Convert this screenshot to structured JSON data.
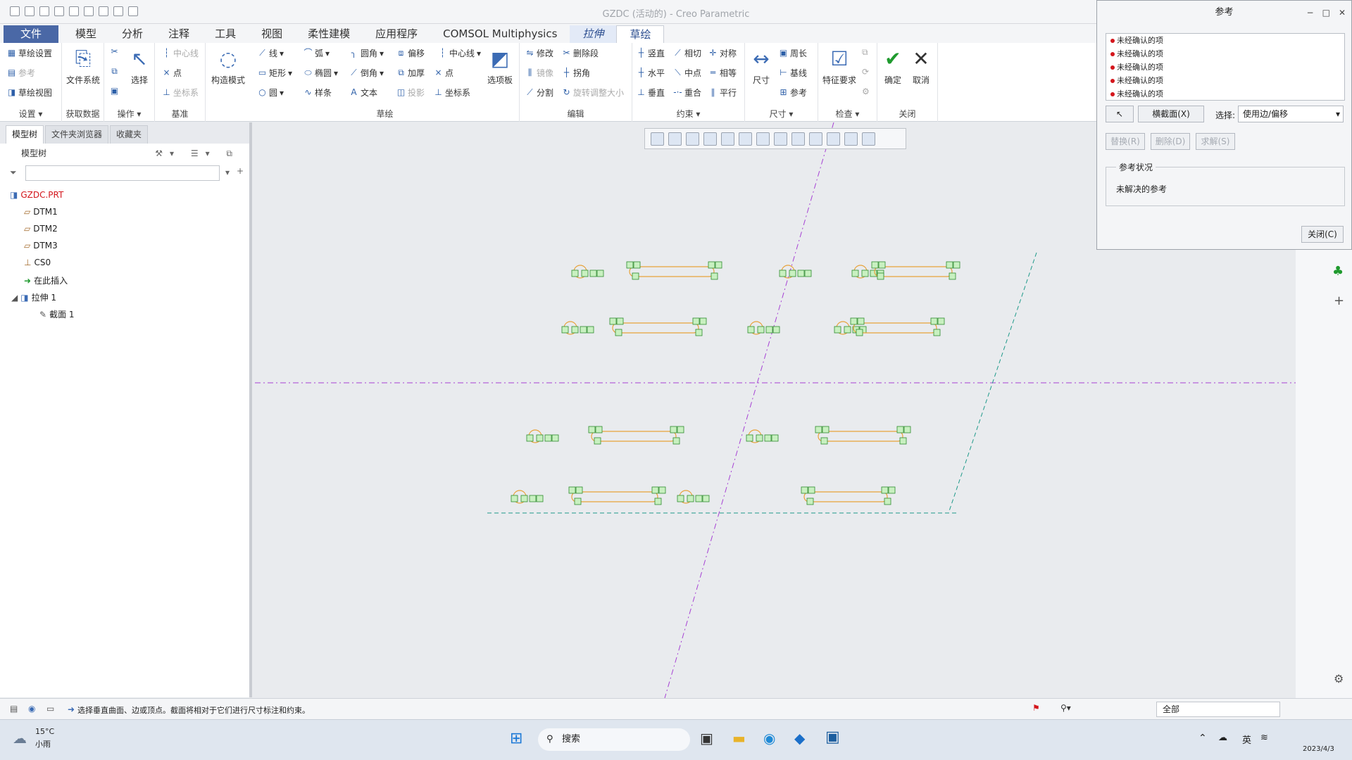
{
  "window": {
    "title": "GZDC (活动的) - Creo Parametric"
  },
  "menu": {
    "tabs": [
      "文件",
      "模型",
      "分析",
      "注释",
      "工具",
      "视图",
      "柔性建模",
      "应用程序",
      "COMSOL Multiphysics",
      "拉伸",
      "草绘"
    ]
  },
  "ribbon": {
    "setup": {
      "sketch_setup": "草绘设置",
      "reference": "参考",
      "sketch_view": "草绘视图",
      "label": "设置 ▾"
    },
    "getdata": {
      "file_system": "文件系统",
      "label": "获取数据"
    },
    "ops": {
      "select": "选择",
      "label": "操作 ▾"
    },
    "datum": {
      "centerline": "中心线",
      "point": "点",
      "csys": "坐标系",
      "label": "基准"
    },
    "construct": {
      "mode": "构造模式"
    },
    "sketch": {
      "line": "线",
      "arc": "弧",
      "fillet": "圆角",
      "offset": "偏移",
      "centerline": "中心线",
      "rect": "矩形",
      "ellipse": "椭圆",
      "chamfer": "倒角",
      "thicken": "加厚",
      "point": "点",
      "circle": "圆",
      "spline": "样条",
      "text": "文本",
      "project": "投影",
      "csys": "坐标系",
      "palette": "选项板",
      "label": "草绘"
    },
    "edit": {
      "modify": "修改",
      "delete_seg": "删除段",
      "mirror": "镜像",
      "corner": "拐角",
      "divide": "分割",
      "rotate_resize": "旋转调整大小",
      "label": "编辑"
    },
    "constrain": {
      "vertical": "竖直",
      "tangent": "相切",
      "symmetric": "对称",
      "horizontal": "水平",
      "midpoint": "中点",
      "equal": "相等",
      "perpendicular": "垂直",
      "coincident": "重合",
      "parallel": "平行",
      "label": "约束 ▾"
    },
    "dimension": {
      "dimension": "尺寸",
      "perimeter": "周长",
      "baseline": "基线",
      "reference": "参考",
      "label": "尺寸 ▾"
    },
    "inspect": {
      "feature_req": "特征要求",
      "label": "检查 ▾"
    },
    "close": {
      "ok": "确定",
      "cancel": "取消",
      "label": "关闭"
    }
  },
  "panel": {
    "tabs": [
      "模型树",
      "文件夹浏览器",
      "收藏夹"
    ],
    "tree_header": "模型树",
    "filter_placeholder": "",
    "items": [
      {
        "label": "GZDC.PRT"
      },
      {
        "label": "DTM1"
      },
      {
        "label": "DTM2"
      },
      {
        "label": "DTM3"
      },
      {
        "label": "CS0"
      },
      {
        "label": "在此插入"
      },
      {
        "label": "拉伸 1"
      },
      {
        "label": "截面 1"
      }
    ]
  },
  "dialog": {
    "title": "参考",
    "refs": [
      "未经确认的项",
      "未经确认的项",
      "未经确认的项",
      "未经确认的项",
      "未经确认的项"
    ],
    "xsec_btn": "横截面(X)",
    "select_label": "选择:",
    "select_value": "使用边/偏移",
    "replace": "替换(R)",
    "delete": "删除(D)",
    "solve": "求解(S)",
    "status_header": "参考状况",
    "status_text": "未解决的参考",
    "close": "关闭(C)"
  },
  "statusbar": {
    "message": "选择垂直曲面、边或顶点。截面将相对于它们进行尺寸标注和约束。",
    "filter": "全部"
  },
  "taskbar": {
    "weather_temp": "15°C",
    "weather_desc": "小雨",
    "search": "搜索",
    "lang": "英",
    "date": "2023/4/3"
  },
  "colors": {
    "accent": "#4a68a6",
    "constraint": "#2e8b2e",
    "sketch": "#e8a23a",
    "datum": "#a641d4",
    "ref": "#1f9a8a"
  }
}
